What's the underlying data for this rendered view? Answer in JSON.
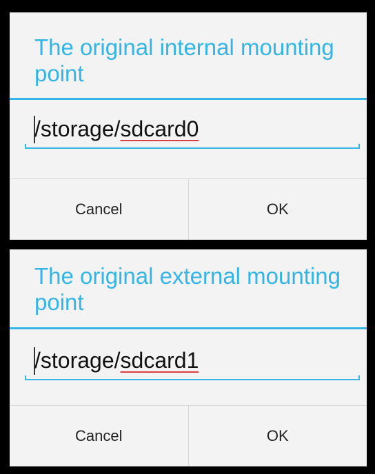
{
  "dialogs": [
    {
      "title": "The original internal mounting point",
      "input": {
        "prefix": "/storage/",
        "misspelled": "sdcard0"
      },
      "buttons": {
        "cancel": "Cancel",
        "ok": "OK"
      }
    },
    {
      "title": "The original external mounting point",
      "input": {
        "prefix": "/storage/",
        "misspelled": "sdcard1"
      },
      "buttons": {
        "cancel": "Cancel",
        "ok": "OK"
      }
    }
  ],
  "colors": {
    "accent": "#34b5e5",
    "dialog_background": "#f3f3f3",
    "backdrop": "#000000",
    "spellcheck_underline": "#d94040"
  }
}
